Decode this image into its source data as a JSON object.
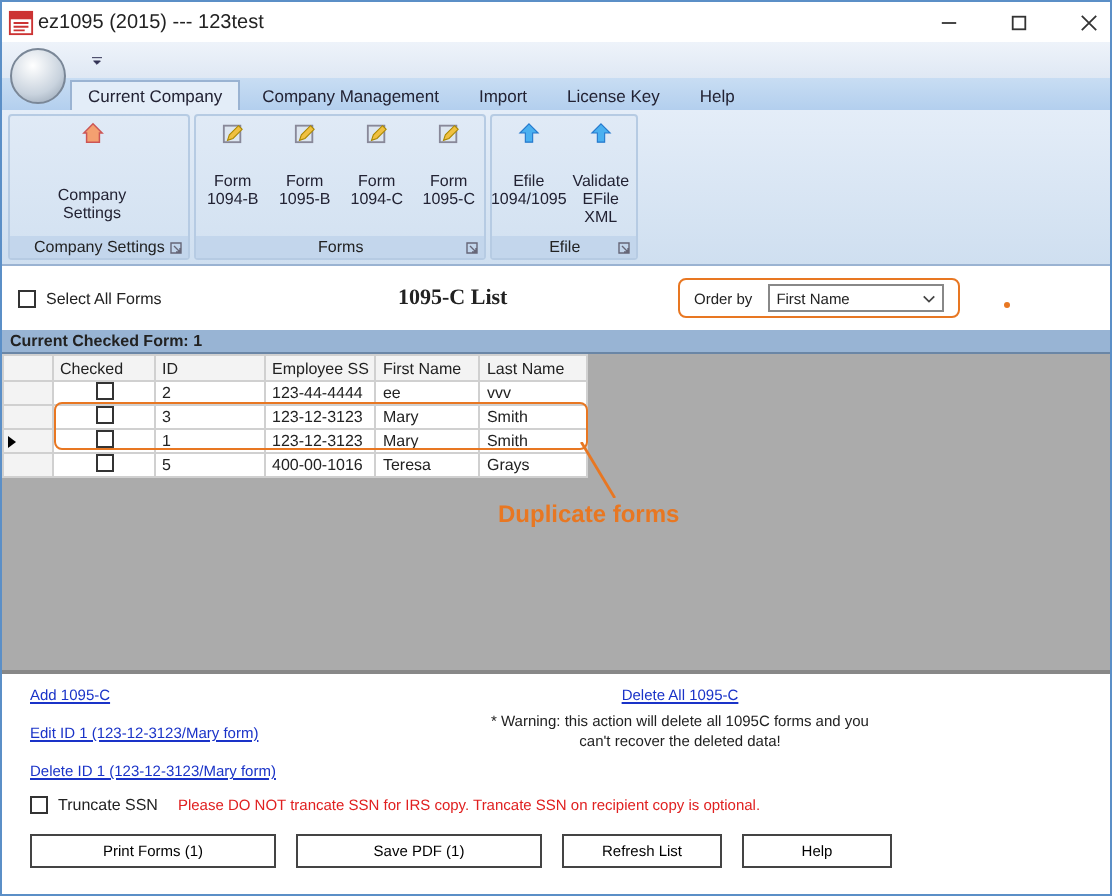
{
  "window": {
    "title": "ez1095 (2015) --- 123test"
  },
  "ribbon_tabs": [
    {
      "label": "Current Company",
      "selected": true
    },
    {
      "label": "Company Management",
      "selected": false
    },
    {
      "label": "Import",
      "selected": false
    },
    {
      "label": "License Key",
      "selected": false
    },
    {
      "label": "Help",
      "selected": false
    }
  ],
  "ribbon_groups": [
    {
      "title": "Company Settings",
      "buttons": [
        {
          "label": "Company Settings",
          "kind": "house"
        }
      ]
    },
    {
      "title": "Forms",
      "buttons": [
        {
          "label": "Form 1094-B",
          "kind": "form"
        },
        {
          "label": "Form 1095-B",
          "kind": "form"
        },
        {
          "label": "Form 1094-C",
          "kind": "form"
        },
        {
          "label": "Form 1095-C",
          "kind": "form"
        }
      ]
    },
    {
      "title": "Efile",
      "buttons": [
        {
          "label": "Efile 1094/1095",
          "kind": "upload"
        },
        {
          "label": "Validate EFile XML",
          "kind": "upload"
        }
      ]
    }
  ],
  "select_all": {
    "label": "Select All Forms",
    "checked": false
  },
  "list_title": "1095-C List",
  "order_by": {
    "label": "Order by",
    "value": "First Name"
  },
  "checked_bar": "Current Checked Form: 1",
  "table": {
    "checkbox_column": "Checked",
    "columns": [
      "ID",
      "Employee SS",
      "First Name",
      "Last Name"
    ],
    "rows": [
      {
        "checked": false,
        "current": false,
        "cells": [
          "2",
          "123-44-4444",
          "ee",
          "vvv"
        ]
      },
      {
        "checked": false,
        "current": false,
        "cells": [
          "3",
          "123-12-3123",
          "Mary",
          "Smith"
        ]
      },
      {
        "checked": false,
        "current": true,
        "cells": [
          "1",
          "123-12-3123",
          "Mary",
          "Smith"
        ]
      },
      {
        "checked": false,
        "current": false,
        "cells": [
          "5",
          "400-00-1016",
          "Teresa",
          "Grays"
        ]
      }
    ]
  },
  "annotation": "Duplicate forms",
  "links": [
    "Add 1095-C",
    "Edit ID 1 (123-12-3123/Mary form)",
    "Delete ID 1 (123-12-3123/Mary form)"
  ],
  "delete_all_link": "Delete All 1095-C",
  "warning": "* Warning: this action will delete all 1095C forms and you can't recover the deleted data!",
  "truncate_ssn": {
    "label": "Truncate SSN",
    "checked": false
  },
  "truncate_note": "Please DO NOT trancate SSN for IRS copy. Trancate SSN on recipient copy is optional.",
  "buttons": [
    "Print Forms (1)",
    "Save PDF (1)",
    "Refresh List",
    "Help"
  ]
}
